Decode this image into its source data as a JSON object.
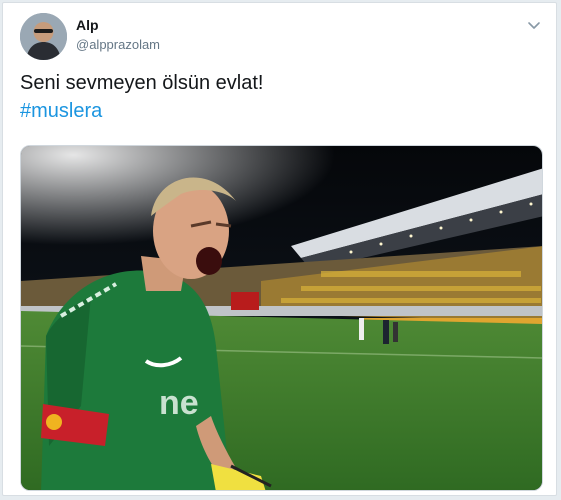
{
  "tweet": {
    "author_name": "Alp",
    "author_handle": "@alpprazolam",
    "text": "Seni sevmeyen ölsün evlat!",
    "hashtag": "#muslera",
    "image_icon": "photo",
    "menu_icon": "chevron-down-icon",
    "colors": {
      "link": "#1b95e0",
      "text": "#14171a",
      "secondary": "#657786"
    }
  }
}
